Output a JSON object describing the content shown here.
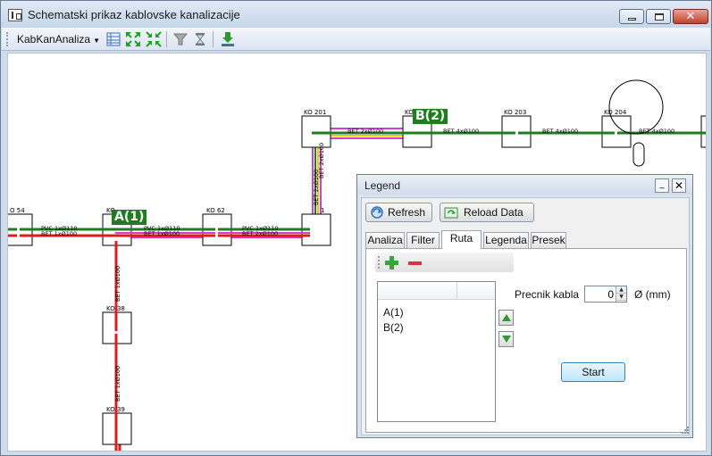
{
  "window": {
    "title": "Schematski prikaz kablovske kanalizacije"
  },
  "toolbar": {
    "dropdown_label": "KabKanAnaliza",
    "buttons": [
      "table-icon",
      "expand-icon",
      "collapse-icon",
      "filter-icon",
      "hourglass-icon",
      "download-icon"
    ]
  },
  "diagram": {
    "nodes": [
      "O 54",
      "KO",
      "KO 62",
      "KO 201",
      "KO",
      "KO 203",
      "KO 204",
      "1",
      "KO 38",
      "KO 39"
    ],
    "tags": [
      "A(1)",
      "B(2)"
    ],
    "edge_labels": [
      "PVC 1xØ110",
      "BET 1xØ100",
      "PVC 1xØ110",
      "BET 1xØ100",
      "PVC 1xØ110",
      "BET 2xØ100",
      "BET 2xØ100",
      "BET 4xØ100",
      "BET 4xØ100",
      "BET 4xØ100",
      "BET 2xØ100",
      "BET 2xØ100",
      "BET 1xØ100",
      "BET 1xØ100"
    ]
  },
  "legend": {
    "title": "Legend",
    "refresh_label": "Refresh",
    "reload_label": "Reload Data",
    "tabs": [
      "Analiza",
      "Filter",
      "Ruta",
      "Legenda",
      "Presek"
    ],
    "active_tab": "Ruta",
    "route_items": [
      "A(1)",
      "B(2)"
    ],
    "precnik_label": "Precnik kabla",
    "precnik_value": "0",
    "unit_label": "Ø (mm)",
    "start_label": "Start"
  },
  "colors": {
    "green_route": "#1f7d1f",
    "red_route": "#e21b1b",
    "magenta_route": "#d83ad8",
    "yellow_route": "#e8d000"
  }
}
